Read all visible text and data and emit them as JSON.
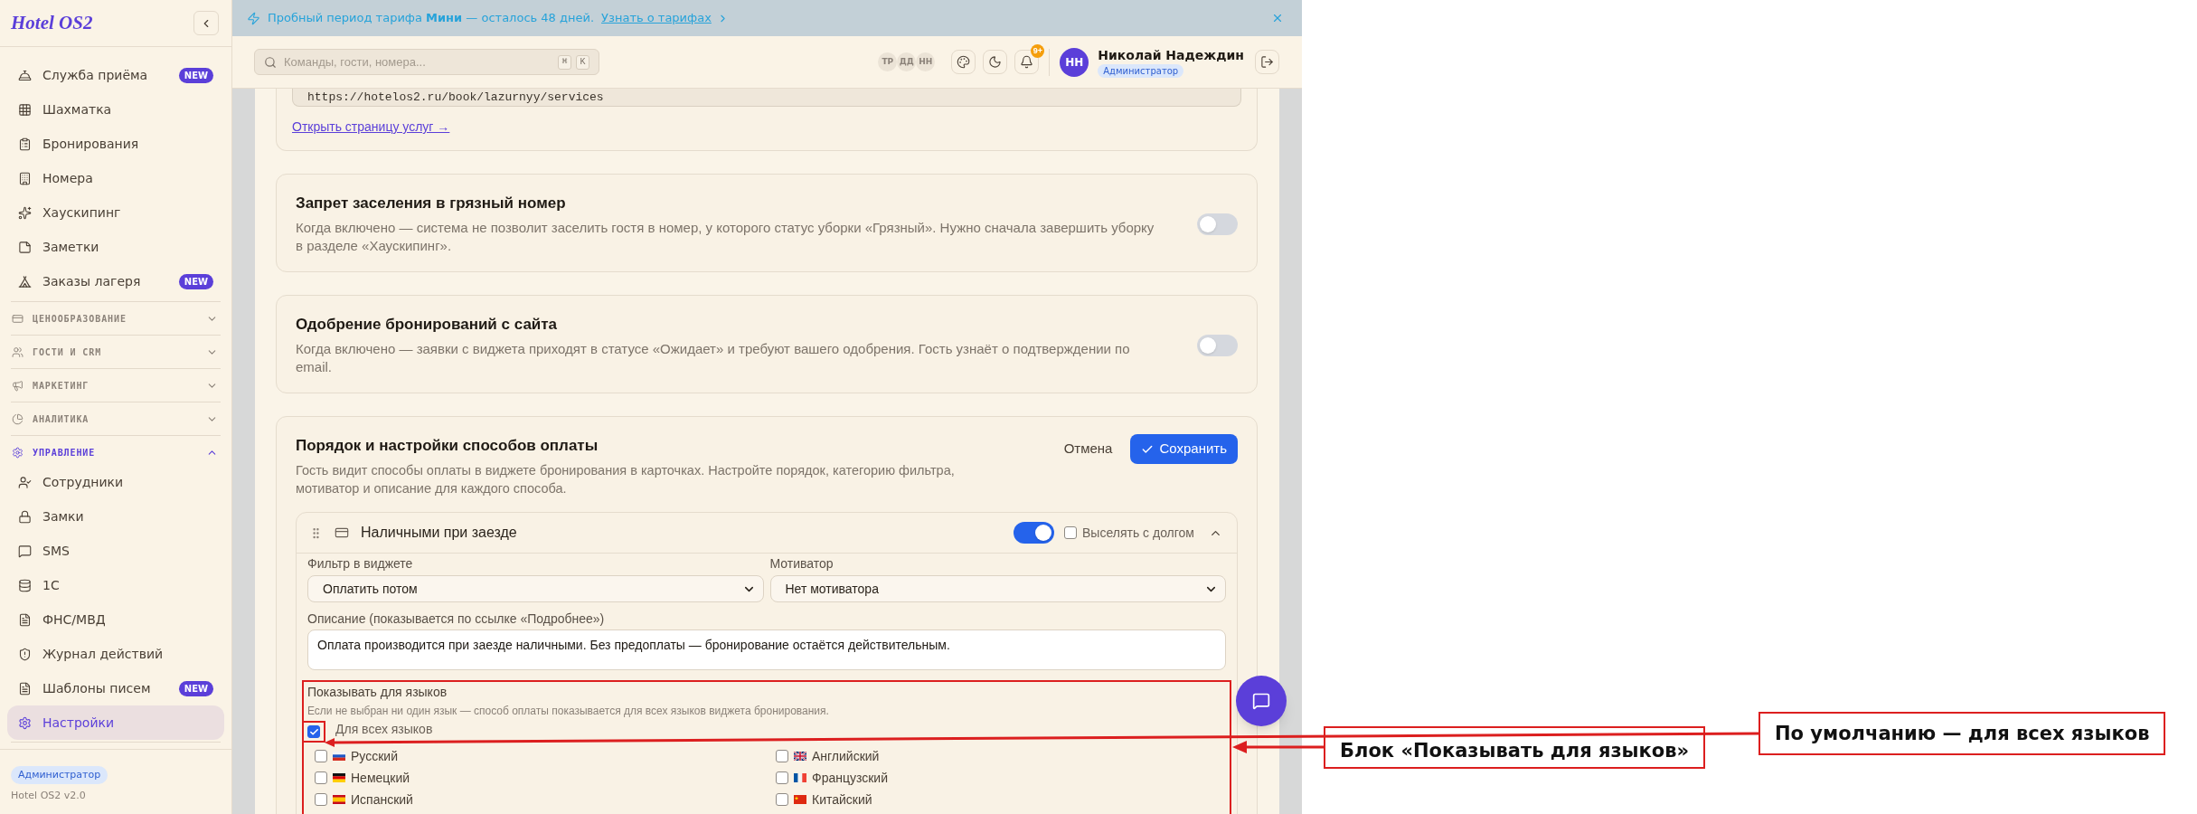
{
  "banner": {
    "text": "Пробный период тарифа **Мини** — осталось 48 дней.",
    "link": "Узнать о тарифах"
  },
  "sidebar": {
    "logo": "Hotel OS2",
    "items": [
      {
        "label": "Служба приёма",
        "badge": "NEW",
        "selected": false
      },
      {
        "label": "Шахматка",
        "selected": false
      },
      {
        "label": "Бронирования",
        "selected": false
      },
      {
        "label": "Номера",
        "selected": false
      },
      {
        "label": "Хаускипинг",
        "selected": false
      },
      {
        "label": "Заметки",
        "selected": false
      },
      {
        "label": "Заказы лагеря",
        "badge": "NEW",
        "selected": false
      }
    ],
    "sections": [
      {
        "title": "ЦЕНООБРАЗОВАНИЕ",
        "expanded": false
      },
      {
        "title": "ГОСТИ И CRM",
        "expanded": false
      },
      {
        "title": "МАРКЕТИНГ",
        "expanded": false
      },
      {
        "title": "АНАЛИТИКА",
        "expanded": false
      },
      {
        "title": "УПРАВЛЕНИЕ",
        "expanded": true,
        "items": [
          {
            "label": "Сотрудники",
            "selected": false
          },
          {
            "label": "Замки",
            "selected": false
          },
          {
            "label": "SMS",
            "selected": false
          },
          {
            "label": "1С",
            "selected": false
          },
          {
            "label": "ФНС/МВД",
            "selected": false
          },
          {
            "label": "Журнал действий",
            "selected": false
          },
          {
            "label": "Шаблоны писем",
            "badge": "NEW",
            "selected": false
          },
          {
            "label": "Настройки",
            "selected": true
          }
        ]
      }
    ],
    "footer": {
      "role": "Администратор",
      "version": "Hotel OS2 v2.0"
    }
  },
  "header": {
    "search": {
      "placeholder": "Команды, гости, номера...",
      "shortcut_keys": [
        "⌘",
        "K"
      ]
    },
    "online_users": [
      "ТР",
      "ДД",
      "НН"
    ],
    "notifications_badge": "9+",
    "user": {
      "initials": "НН",
      "name": "Николай Надеждин",
      "role": "Администратор"
    }
  },
  "settings": {
    "booking_link_card": {
      "url": "https://hotelos2.ru/book/lazurnyy/services",
      "link": "Открыть страницу услуг →"
    },
    "toggle_cards": [
      {
        "title": "Запрет заселения в грязный номер",
        "description": "Когда включено — система не позволит заселить гостя в номер, у которого статус уборки «Грязный». Нужно сначала завершить уборку в разделе «Хаускипинг».",
        "on": false
      },
      {
        "title": "Одобрение бронирований с сайта",
        "description": "Когда включено — заявки с виджета приходят в статусе «Ожидает» и требуют вашего одобрения. Гость узнаёт о подтверждении по email.",
        "on": false
      }
    ],
    "payment_card": {
      "title": "Порядок и настройки способов оплаты",
      "description": "Гость видит способы оплаты в виджете бронирования в карточках. Настройте порядок, категорию фильтра, мотиватор и описание для каждого способа.",
      "cancel": "Отмена",
      "save": "Сохранить",
      "methods": [
        {
          "name": "Наличными при заезде",
          "on": true,
          "expanded": true,
          "evict_with_debt": {
            "label": "Выселять с долгом",
            "checked": false
          },
          "filter": {
            "label": "Фильтр в виджете",
            "value": "Оплатить потом"
          },
          "motivator": {
            "label": "Мотиватор",
            "value": "Нет мотиватора"
          },
          "description": {
            "label": "Описание (показывается по ссылке «Подробнее»)",
            "value": "Оплата производится при заезде наличными. Без предоплаты — бронирование остаётся действительным."
          },
          "languages": {
            "title": "Показывать для языков",
            "hint": "Если не выбран ни один язык — способ оплаты показывается для всех языков виджета бронирования.",
            "all": {
              "label": "Для всех языков",
              "checked": true
            },
            "options": [
              {
                "label": "Русский",
                "checked": false
              },
              {
                "label": "Английский",
                "checked": false
              },
              {
                "label": "Немецкий",
                "checked": false
              },
              {
                "label": "Французский",
                "checked": false
              },
              {
                "label": "Испанский",
                "checked": false
              },
              {
                "label": "Китайский",
                "checked": false
              }
            ]
          }
        }
      ]
    }
  },
  "annotations": [
    {
      "text": "Блок «Показывать для языков»"
    },
    {
      "text": "По умолчанию — для всех языков"
    }
  ]
}
